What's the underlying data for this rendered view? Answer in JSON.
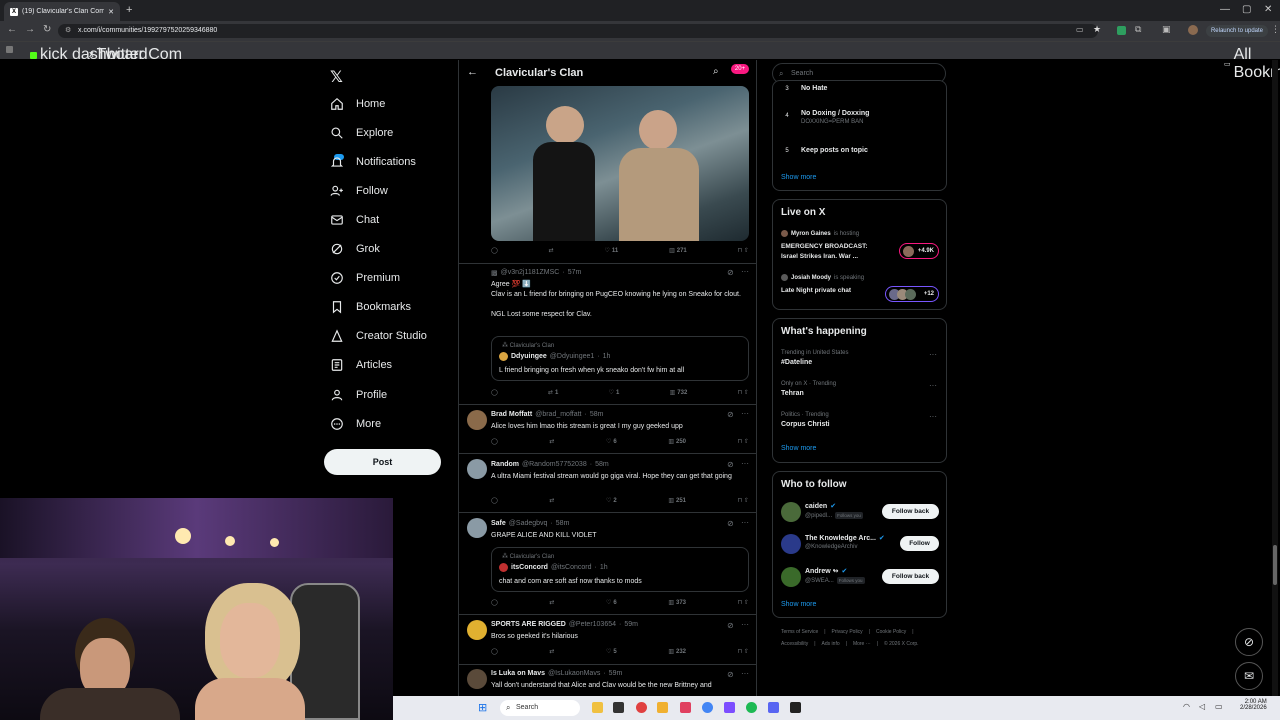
{
  "browser": {
    "tab_title": "(19) Clavicular's Clan Communi...",
    "url": "x.com/i/communities/1992797520259346880",
    "relaunch_label": "Relaunch to update",
    "bookmarks": [
      "kick dashboard",
      "Twitter Com"
    ],
    "all_bookmarks": "All Bookmarks"
  },
  "nav": {
    "items": [
      "Home",
      "Explore",
      "Notifications",
      "Follow",
      "Chat",
      "Grok",
      "Premium",
      "Bookmarks",
      "Creator Studio",
      "Articles",
      "Profile",
      "More"
    ],
    "post_label": "Post"
  },
  "community": {
    "title": "Clavicular's Clan",
    "badge": "20+"
  },
  "tweets": [
    {
      "replies": "",
      "retweets": "",
      "likes": "11",
      "views": "271"
    },
    {
      "handle": "@v3n2j1181ZMSC",
      "time": "57m",
      "lines": [
        "Agree 💯 ⬇️",
        "Clav is an L friend for bringing on PugCEO knowing he lying on Sneako for clout.",
        "",
        "NGL Lost some respect for Clav."
      ],
      "quote": {
        "community": "Clavicular's Clan",
        "name": "Ddyuingee",
        "handle": "@Ddyuingee1",
        "time": "1h",
        "text": "L friend bringing on fresh when yk sneako don't fw him at all"
      },
      "replies": "",
      "retweets": "1",
      "likes": "1",
      "views": "732"
    },
    {
      "name": "Brad Moffatt",
      "handle": "@brad_moffatt",
      "time": "58m",
      "text": "Alice loves him lmao this stream is great I my guy geeked upp",
      "likes": "6",
      "views": "250"
    },
    {
      "name": "Random",
      "handle": "@Random57752038",
      "time": "58m",
      "text": "A ultra Miami festival stream would go giga viral. Hope they can get that going",
      "likes": "2",
      "views": "251"
    },
    {
      "name": "Safe",
      "handle": "@Sadegbvq",
      "time": "58m",
      "text": "GRAPE ALICE AND KILL VIOLET",
      "quote": {
        "community": "Clavicular's Clan",
        "name": "itsConcord",
        "handle": "@itsConcord",
        "time": "1h",
        "text": "chat and com are soft asf now thanks to mods"
      },
      "likes": "6",
      "views": "373"
    },
    {
      "name": "SPORTS ARE RIGGED",
      "handle": "@Peter103654",
      "time": "59m",
      "text": "Bros so geeked it's hilarious",
      "likes": "5",
      "views": "232"
    },
    {
      "name": "Is Luka on Mavs",
      "handle": "@IsLukaonMavs",
      "time": "59m",
      "text": "Yall don't understand that Alice and Clav would be the new Brittney and"
    }
  ],
  "right": {
    "search_placeholder": "Search",
    "rules": [
      {
        "num": "3",
        "title": "No Hate",
        "sub": ""
      },
      {
        "num": "4",
        "title": "No Doxing / Doxxing",
        "sub": "DOXXING=PERM BAN"
      },
      {
        "num": "5",
        "title": "Keep posts on topic",
        "sub": ""
      }
    ],
    "show_more": "Show more",
    "live": {
      "title": "Live on X",
      "items": [
        {
          "host": "Myron Gaines",
          "verb": "is hosting",
          "title": "EMERGENCY BROADCAST: Israel Strikes Iran. War ...",
          "count": "+4.9K"
        },
        {
          "host": "Josiah Moody",
          "verb": "is speaking",
          "title": "Late Night private chat",
          "count": "+12"
        }
      ]
    },
    "happening": {
      "title": "What's happening",
      "items": [
        {
          "context": "Trending in United States",
          "topic": "#Dateline"
        },
        {
          "context": "Only on X · Trending",
          "topic": "Tehran"
        },
        {
          "context": "Politics · Trending",
          "topic": "Corpus Christi"
        }
      ]
    },
    "who_to_follow": {
      "title": "Who to follow",
      "items": [
        {
          "name": "caiden",
          "handle": "@pipedl...",
          "follows_you": "Follows you",
          "button": "Follow back"
        },
        {
          "name": "The Knowledge Arc...",
          "handle": "@KnowledgeArchiv",
          "follows_you": "",
          "button": "Follow"
        },
        {
          "name": "Andrew ↬",
          "handle": "@SWEA...",
          "follows_you": "Follows you",
          "button": "Follow back"
        }
      ]
    },
    "footer": [
      "Terms of Service",
      "Privacy Policy",
      "Cookie Policy",
      "Accessibility",
      "Ads info",
      "More ···",
      "© 2026 X Corp."
    ]
  },
  "taskbar": {
    "search_placeholder": "Search",
    "time": "2:00 AM",
    "date": "2/28/2026"
  },
  "colors": {
    "accent": "#1d9bf0",
    "background": "#000000",
    "border": "#2f3336",
    "muted": "#71767b"
  }
}
